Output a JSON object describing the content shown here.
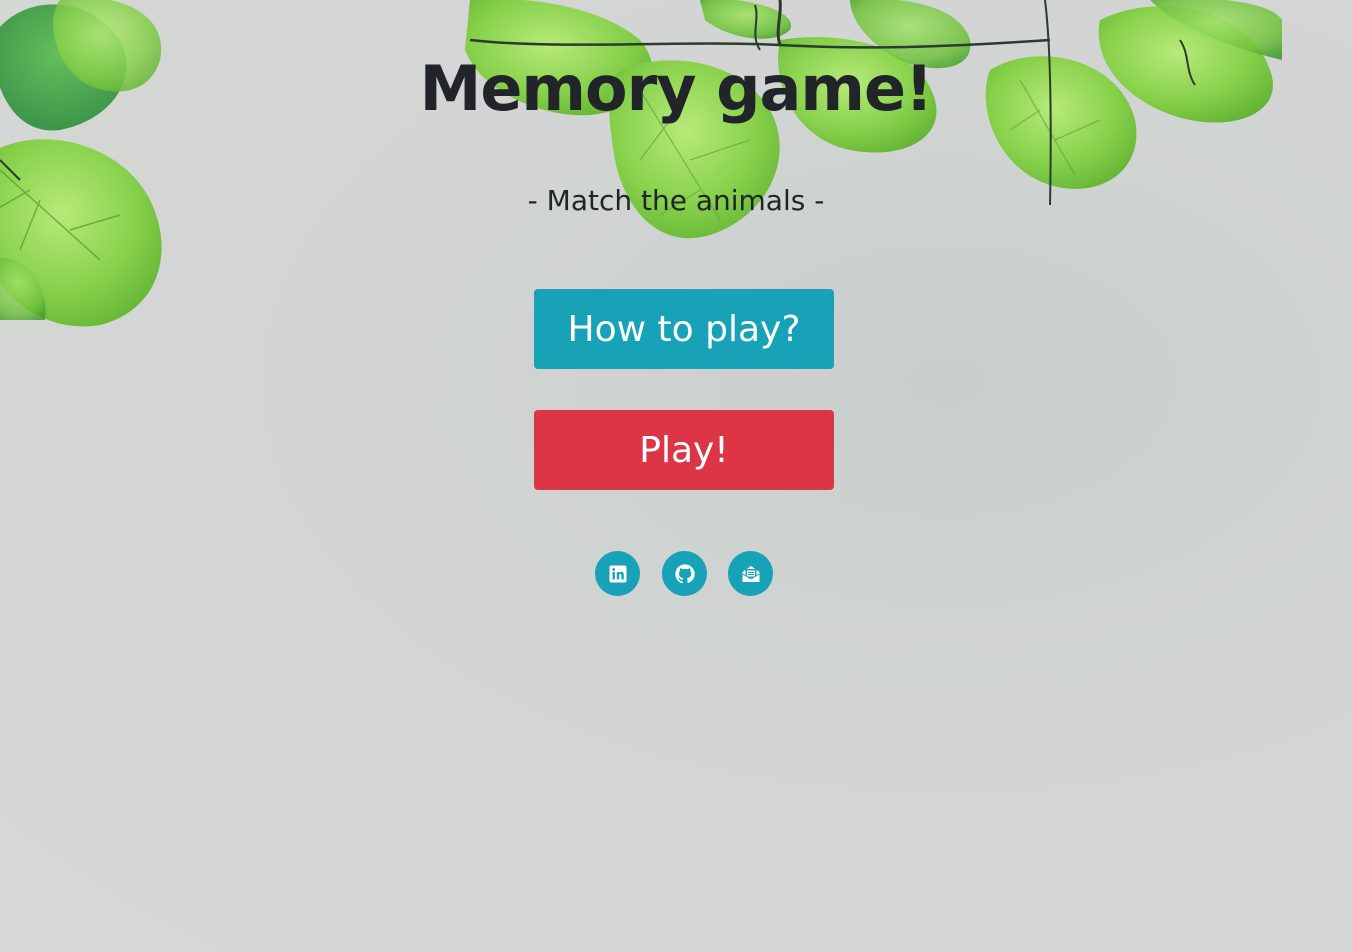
{
  "page": {
    "title": "Memory game!",
    "subtitle": "- Match the animals -"
  },
  "buttons": {
    "how_to_play": "How to play?",
    "play": "Play!"
  },
  "social_links": [
    {
      "icon": "linkedin-icon"
    },
    {
      "icon": "github-icon"
    },
    {
      "icon": "mail-icon"
    }
  ],
  "colors": {
    "info": "#17a2b8",
    "danger": "#dc3545",
    "text": "#212529",
    "leaf": "#8fd14f"
  }
}
